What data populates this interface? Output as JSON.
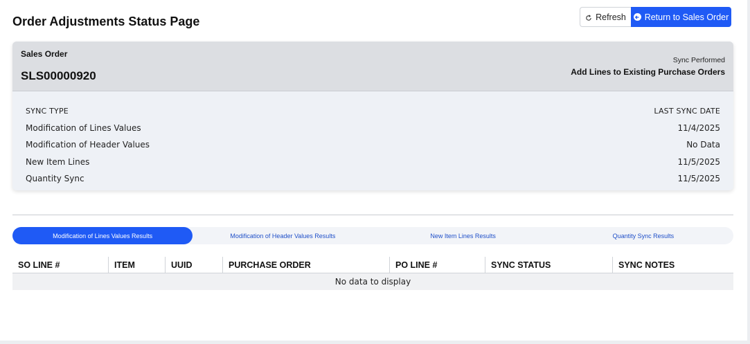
{
  "page": {
    "title": "Order Adjustments Status Page"
  },
  "actions": {
    "refresh_label": "Refresh",
    "return_label": "Return to Sales Order",
    "accent_color": "#1f5af5"
  },
  "summary": {
    "so_label": "Sales Order",
    "so_number": "SLS00000920",
    "sync_label": "Sync Performed",
    "sync_value": "Add Lines to Existing Purchase Orders"
  },
  "sync_table": {
    "headers": {
      "type": "SYNC TYPE",
      "date": "LAST SYNC DATE"
    },
    "rows": [
      {
        "type": "Modification of Lines Values",
        "date": "11/4/2025"
      },
      {
        "type": "Modification of Header Values",
        "date": "No Data"
      },
      {
        "type": "New Item Lines",
        "date": "11/5/2025"
      },
      {
        "type": "Quantity Sync",
        "date": "11/5/2025"
      }
    ]
  },
  "tabs": [
    {
      "label": "Modification of Lines Values Results",
      "active": true
    },
    {
      "label": "Modification of Header Values Results",
      "active": false
    },
    {
      "label": "New Item Lines Results",
      "active": false
    },
    {
      "label": "Quantity Sync Results",
      "active": false
    }
  ],
  "results_grid": {
    "columns": [
      "SO LINE #",
      "ITEM",
      "UUID",
      "PURCHASE ORDER",
      "PO LINE #",
      "SYNC STATUS",
      "SYNC NOTES"
    ],
    "empty_message": "No data to display"
  },
  "icons": {
    "refresh": "refresh-icon",
    "return": "back-arrow-icon"
  }
}
